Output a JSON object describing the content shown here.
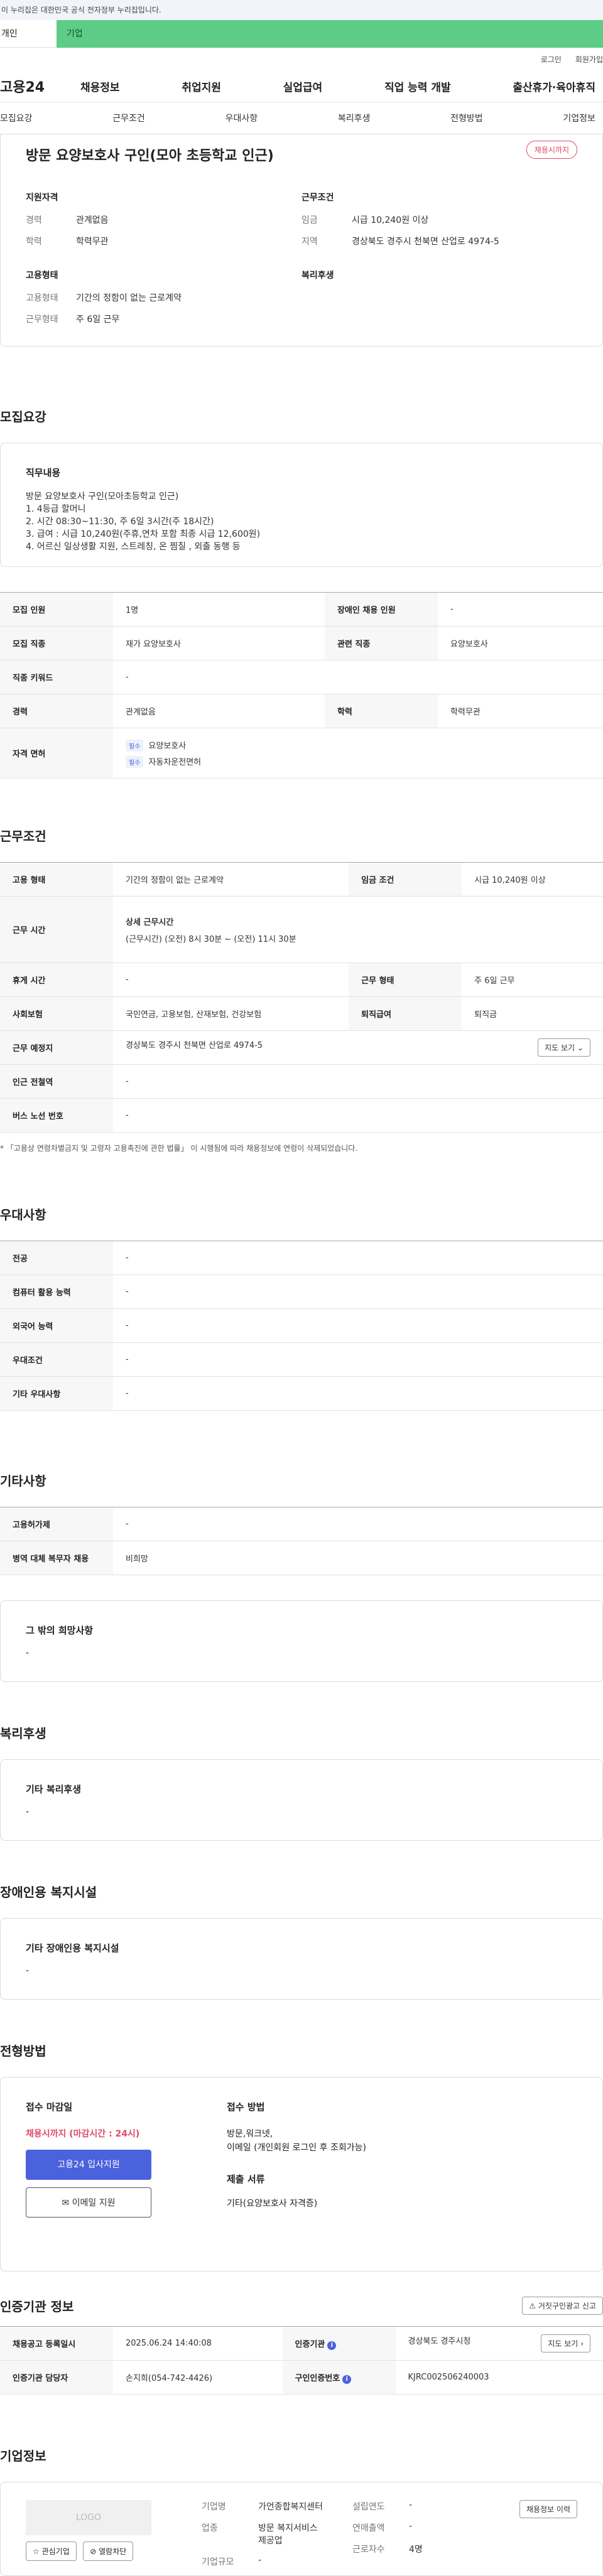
{
  "gov_notice": "이 누리집은 대한민국 공식 전자정부 누리집입니다.",
  "type_tabs": {
    "individual": "개인",
    "company": "기업"
  },
  "util": {
    "login": "로그인",
    "signup": "회원가입"
  },
  "gnb": {
    "logo": "고용24",
    "menu": [
      "채용정보",
      "취업지원",
      "실업급여",
      "직업 능력 개발",
      "출산휴가·육아휴직"
    ]
  },
  "subnav": [
    "모집요강",
    "근무조건",
    "우대사항",
    "복리후생",
    "전형방법",
    "기업정보"
  ],
  "summary": {
    "title": "방문 요양보호사 구인(모아 초등학교 인근)",
    "badge": "채용시까지",
    "qual_title": "지원자격",
    "qual": [
      {
        "k": "경력",
        "v": "관계없음"
      },
      {
        "k": "학력",
        "v": "학력무관"
      }
    ],
    "work_title": "근무조건",
    "work": [
      {
        "k": "임금",
        "v": "시급 10,240원 이상"
      },
      {
        "k": "지역",
        "v": "경상북도 경주시 천북면 산업로 4974-5"
      }
    ],
    "emp_title": "고용형태",
    "emp": [
      {
        "k": "고용형태",
        "v": "기간의 정함이 없는 근로계약"
      },
      {
        "k": "근무형태",
        "v": "주 6일 근무"
      }
    ],
    "welfare_title": "복리후생"
  },
  "recruit": {
    "title": "모집요강",
    "duty_title": "직무내용",
    "duty_lines": [
      "방문 요양보호사 구인(모아초등학교 인근)",
      "1. 4등급 할머니",
      "2. 시간 08:30~11:30, 주 6일 3시간(주 18시간)",
      "3. 급여 : 시급 10,240원(주휴,연차 포함 최종 시급 12,600원)",
      "4. 어르신 일상생활 지원, 스트레칭, 온 찜질 , 외출 동행 등"
    ],
    "rows": [
      {
        "k1": "모집 인원",
        "v1": "1명",
        "k2": "장애인 채용 인원",
        "v2": "-"
      },
      {
        "k1": "모집 직종",
        "v1": "재가 요양보호사",
        "k2": "관련 직종",
        "v2": "요양보호사"
      },
      {
        "k1": "직종 키워드",
        "v1": "-"
      },
      {
        "k1": "경력",
        "v1": "관계없음",
        "k2": "학력",
        "v2": "학력무관"
      }
    ],
    "license_label": "자격 면허",
    "must_label": "필수",
    "licenses": [
      "요양보호사",
      "자동차운전면허"
    ]
  },
  "work": {
    "title": "근무조건",
    "emp_type_k": "고용 형태",
    "emp_type_v": "기간의 정함이 없는 근로계약",
    "wage_k": "임금 조건",
    "wage_v": "시급 10,240원 이상",
    "hours_k": "근무 시간",
    "hours_head": "상세 근무시간",
    "hours_v": "(근무시간) (오전) 8시 30분 ~ (오전) 11시 30분",
    "rest_k": "휴게 시간",
    "rest_v": "-",
    "form_k": "근무 형태",
    "form_v": "주 6일 근무",
    "ins_k": "사회보험",
    "ins_v": "국민연금, 고용보험, 산재보험, 건강보험",
    "sev_k": "퇴직급여",
    "sev_v": "퇴직금",
    "place_k": "근무 예정지",
    "place_v": "경상북도 경주시 천북면 산업로 4974-5",
    "map_btn": "지도 보기",
    "subway_k": "인근 전철역",
    "subway_v": "-",
    "bus_k": "버스 노선 번호",
    "bus_v": "-",
    "note": "* 「고용상 연령차별금지 및 고령자 고용촉진에 관한 법률」 이 시행됨에 따라 채용정보에 연령이 삭제되었습니다."
  },
  "prefer": {
    "title": "우대사항",
    "rows": [
      {
        "k": "전공",
        "v": "-"
      },
      {
        "k": "컴퓨터 활용 능력",
        "v": "-"
      },
      {
        "k": "외국어 능력",
        "v": "-"
      },
      {
        "k": "우대조건",
        "v": "-"
      },
      {
        "k": "기타 우대사항",
        "v": "-"
      }
    ]
  },
  "other": {
    "title": "기타사항",
    "rows": [
      {
        "k": "고용허가제",
        "v": "-"
      },
      {
        "k": "병역 대체 복무자 채용",
        "v": "비희망"
      }
    ],
    "etc_title": "그 밖의 희망사항",
    "etc_v": "-"
  },
  "welfare": {
    "title": "복리후생",
    "card_title": "기타 복리후생",
    "card_v": "-"
  },
  "disabled": {
    "title": "장애인용 복지시설",
    "card_title": "기타 장애인용 복지시설",
    "card_v": "-"
  },
  "process": {
    "title": "전형방법",
    "deadline_k": "접수 마감일",
    "deadline_v": "채용시까지 (마감시간 : 24시)",
    "apply_btn": "고용24 입사지원",
    "email_btn": "이메일 지원",
    "method_k": "접수 방법",
    "method_v1": "방문,워크넷,",
    "method_v2": "이메일 (개인회원 로그인 후 조회가능)",
    "docs_k": "제출 서류",
    "docs_v": "기타(요양보호사 자격증)"
  },
  "agency": {
    "title": "인증기관 정보",
    "report_btn": "거짓구인광고 신고",
    "reg_k": "채용공고 등록일시",
    "reg_v": "2025.06.24 14:40:08",
    "org_k": "인증기관",
    "org_v": "경상북도 경주시청",
    "map_btn": "지도 보기",
    "staff_k": "인증기관 담당자",
    "staff_v": "손지희(054-742-4426)",
    "num_k": "구인인증번호",
    "num_v": "KJRC002506240003"
  },
  "company": {
    "title": "기업정보",
    "logo": "LOGO",
    "fav_btn": "관심기업",
    "block_btn": "열람차단",
    "name_k": "기업명",
    "name_v": "가언종합복지센터",
    "biz_k": "업종",
    "biz_v1": "방문 복지서비스",
    "biz_v2": "제공업",
    "size_k": "기업규모",
    "size_v": "-",
    "year_k": "설립연도",
    "year_v": "-",
    "sales_k": "연매출액",
    "sales_v": "-",
    "emp_k": "근로자수",
    "emp_v": "4명",
    "hist_btn": "채용정보 이력"
  }
}
